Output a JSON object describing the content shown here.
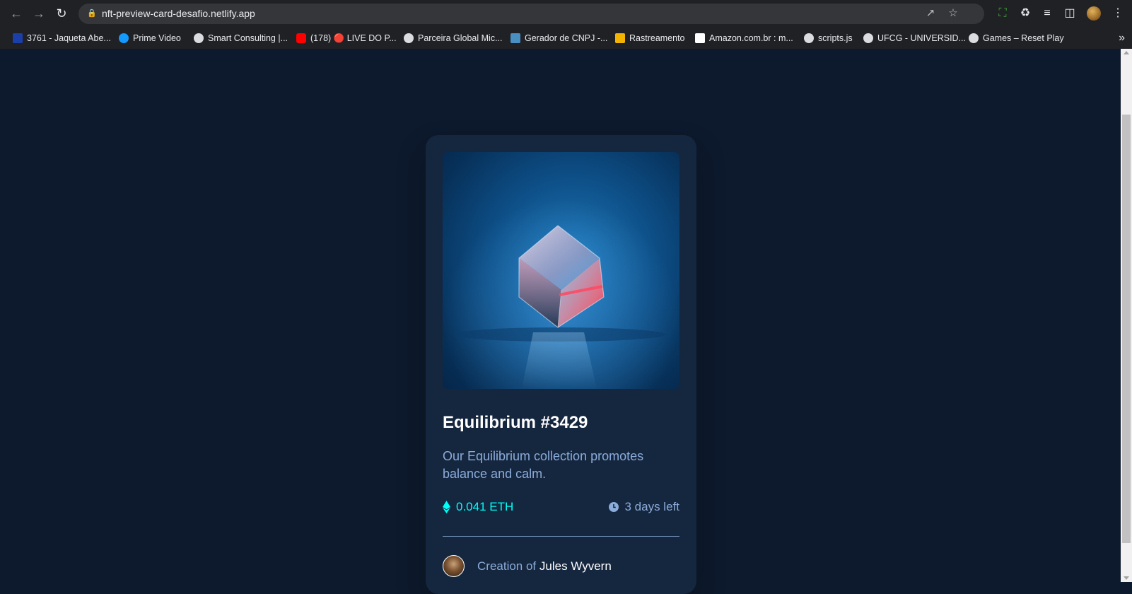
{
  "browser": {
    "url": "nft-preview-card-desafio.netlify.app",
    "bookmarks": [
      {
        "label": "3761 - Jaqueta Abe...",
        "color": "#1b3fa8"
      },
      {
        "label": "Prime Video",
        "color": "#1399ff"
      },
      {
        "label": "Smart Consulting |...",
        "color": "#dadce0"
      },
      {
        "label": "(178) 🔴 LIVE DO P...",
        "color": "#ff0000"
      },
      {
        "label": "Parceira Global Mic...",
        "color": "#dadce0"
      },
      {
        "label": "Gerador de CNPJ -...",
        "color": "#4a8fc2"
      },
      {
        "label": "Rastreamento",
        "color": "#f2b400"
      },
      {
        "label": "Amazon.com.br : m...",
        "color": "#ffffff"
      },
      {
        "label": "scripts.js",
        "color": "#dadce0"
      },
      {
        "label": "UFCG - UNIVERSID...",
        "color": "#dadce0"
      },
      {
        "label": "Games – Reset Play",
        "color": "#dadce0"
      }
    ]
  },
  "card": {
    "title": "Equilibrium #3429",
    "description": "Our Equilibrium collection promotes balance and calm.",
    "price": "0.041 ETH",
    "time_left": "3 days left",
    "creator_prefix": "Creation of",
    "creator_name": "Jules Wyvern"
  },
  "colors": {
    "page_bg": "#0d192c",
    "card_bg": "#15263f",
    "accent_cyan": "#00fff8",
    "soft_blue": "#8bacd9",
    "white": "#ffffff"
  }
}
